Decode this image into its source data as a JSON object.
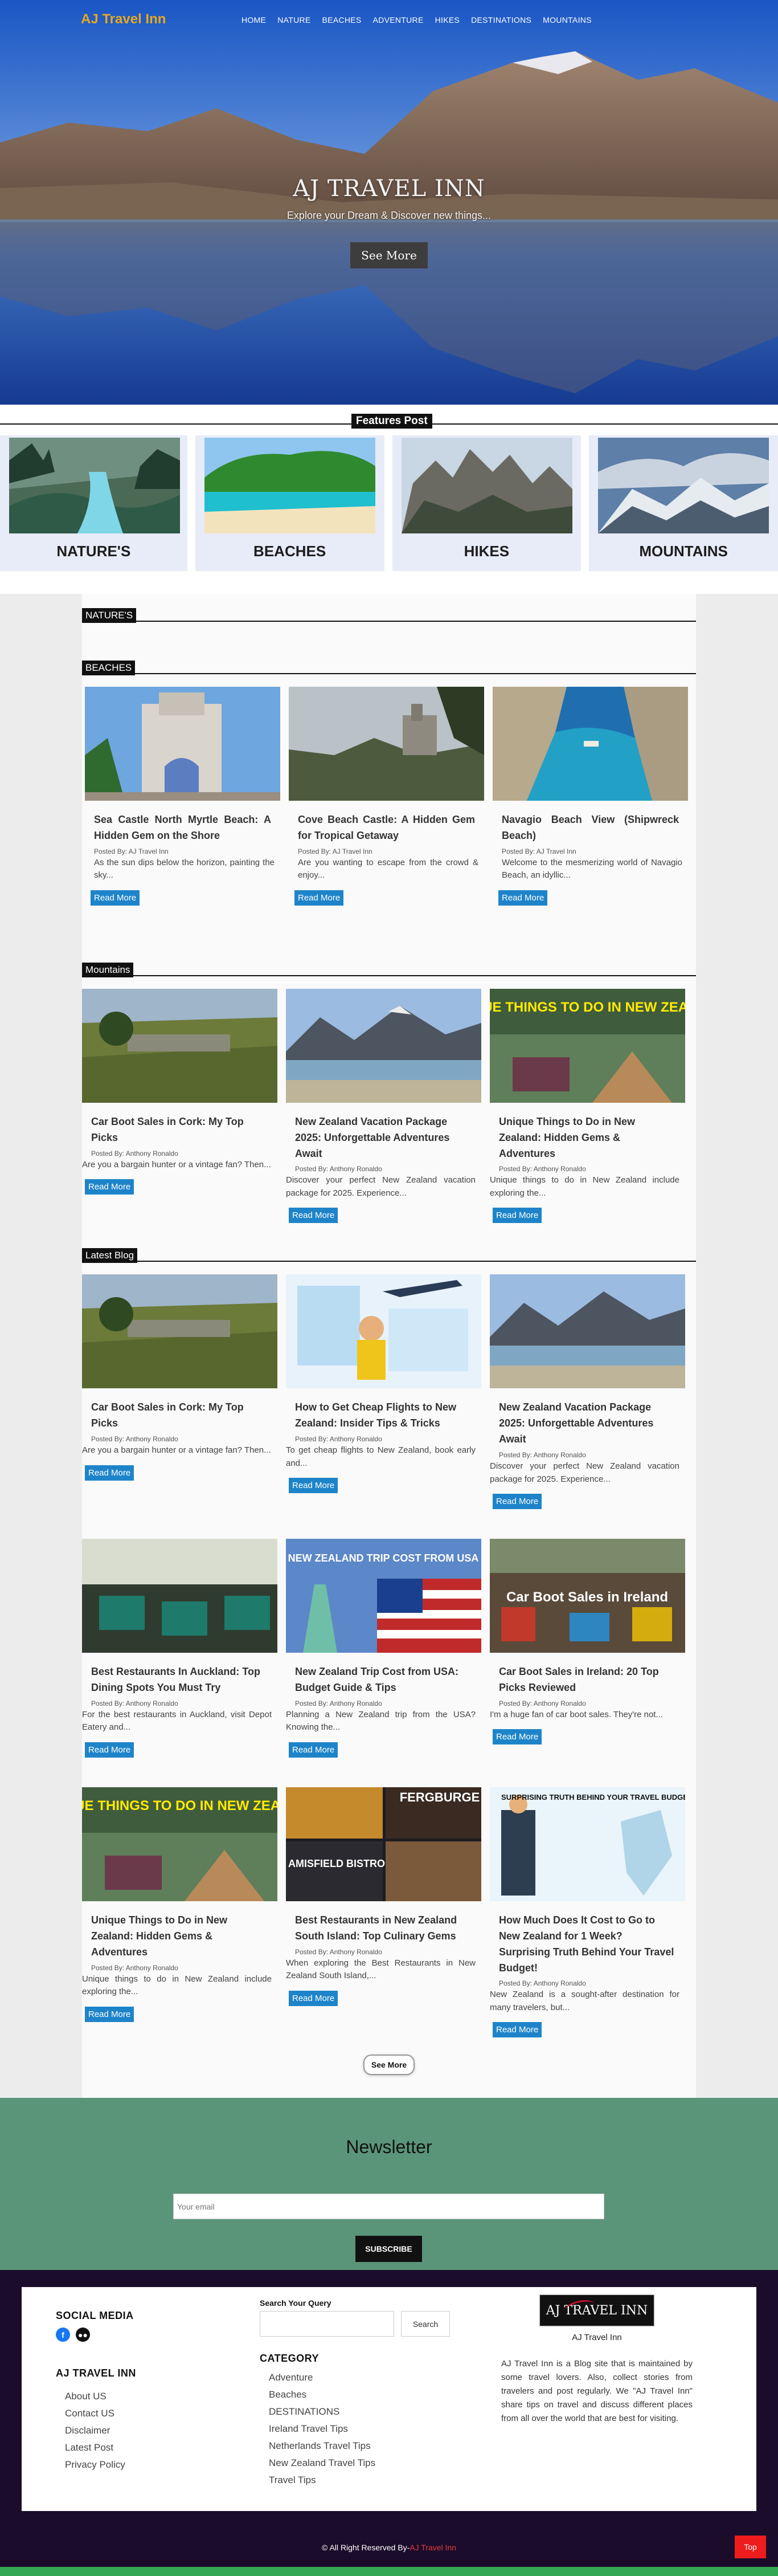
{
  "header": {
    "logo": "AJ Travel Inn",
    "menu": [
      "HOME",
      "NATURE",
      "BEACHES",
      "ADVENTURE",
      "HIKES",
      "DESTINATIONS",
      "MOUNTAINS"
    ]
  },
  "hero": {
    "title": "AJ TRAVEL INN",
    "subtitle": "Explore your Dream & Discover new things...",
    "button": "See More"
  },
  "features": {
    "heading": "Features Post",
    "cards": [
      "NATURE'S",
      "BEACHES",
      "HIKES",
      "MOUNTAINS"
    ]
  },
  "sections": {
    "nature": "NATURE'S",
    "beaches": "BEACHES",
    "mountains": "Mountains",
    "latest": "Latest Blog"
  },
  "beach_posts": [
    {
      "title": "Sea Castle North Myrtle Beach: A Hidden Gem on the Shore",
      "by": "Posted By: AJ Travel Inn",
      "excerpt": "As the sun dips below the horizon, painting the sky...",
      "button": "Read More"
    },
    {
      "title": "Cove Beach Castle: A Hidden Gem for Tropical Getaway",
      "by": "Posted By: AJ Travel Inn",
      "excerpt": "Are you wanting to escape from the crowd & enjoy...",
      "button": "Read More"
    },
    {
      "title": "Navagio Beach View (Shipwreck Beach)",
      "by": "Posted By: AJ Travel Inn",
      "excerpt": "Welcome to the mesmerizing world of Navagio Beach, an idyllic...",
      "button": "Read More"
    }
  ],
  "mountain_posts": [
    {
      "title": "Car Boot Sales in Cork: My Top Picks",
      "by": "Posted By: Anthony Ronaldo",
      "excerpt": "Are you a bargain hunter or a vintage fan? Then...",
      "button": "Read More"
    },
    {
      "title": "New Zealand Vacation Package 2025: Unforgettable Adventures Await",
      "by": "Posted By: Anthony Ronaldo",
      "excerpt": "Discover your perfect New Zealand vacation package for 2025. Experience...",
      "button": "Read More"
    },
    {
      "title": "Unique Things to Do in New Zealand: Hidden Gems & Adventures",
      "by": "Posted By: Anthony Ronaldo",
      "excerpt": "Unique things to do in New Zealand include exploring the...",
      "button": "Read More",
      "overlay": "UNIQUE THINGS TO DO IN NEW ZEALAND"
    }
  ],
  "latest_posts": [
    {
      "title": "Car Boot Sales in Cork: My Top Picks",
      "by": "Posted By: Anthony Ronaldo",
      "excerpt": "Are you a bargain hunter or a vintage fan? Then...",
      "button": "Read More"
    },
    {
      "title": "How to Get Cheap Flights to New Zealand: Insider Tips & Tricks",
      "by": "Posted By: Anthony Ronaldo",
      "excerpt": "To get cheap flights to New Zealand, book early and...",
      "button": "Read More"
    },
    {
      "title": "New Zealand Vacation Package 2025: Unforgettable Adventures Await",
      "by": "Posted By: Anthony Ronaldo",
      "excerpt": "Discover your perfect New Zealand vacation package for 2025. Experience...",
      "button": "Read More"
    },
    {
      "title": "Best Restaurants In Auckland: Top Dining Spots You Must Try",
      "by": "Posted By: Anthony Ronaldo",
      "excerpt": "For the best restaurants in Auckland, visit Depot Eatery and...",
      "button": "Read More"
    },
    {
      "title": "New Zealand Trip Cost from USA: Budget Guide & Tips",
      "by": "Posted By: Anthony Ronaldo",
      "excerpt": "Planning a New Zealand trip from the USA? Knowing the...",
      "button": "Read More",
      "overlay": "NEW ZEALAND TRIP COST FROM USA"
    },
    {
      "title": "Car Boot Sales in Ireland: 20 Top Picks Reviewed",
      "by": "Posted By: Anthony Ronaldo",
      "excerpt": "I'm a huge fan of car boot sales. They're not...",
      "button": "Read More",
      "overlay": "Car Boot Sales in Ireland"
    },
    {
      "title": "Unique Things to Do in New Zealand: Hidden Gems & Adventures",
      "by": "Posted By: Anthony Ronaldo",
      "excerpt": "Unique things to do in New Zealand include exploring the...",
      "button": "Read More",
      "overlay": "UNIQUE THINGS TO DO IN NEW ZEALAND"
    },
    {
      "title": "Best Restaurants in New Zealand South Island: Top Culinary Gems",
      "by": "Posted By: Anthony Ronaldo",
      "excerpt": "When exploring the Best Restaurants in New Zealand South Island,...",
      "button": "Read More",
      "overlay_a": "FERGBURGE",
      "overlay_b": "AMISFIELD BISTRO"
    },
    {
      "title": "How Much Does It Cost to Go to New Zealand for 1 Week? Surprising Truth Behind Your Travel Budget!",
      "by": "Posted By: Anthony Ronaldo",
      "excerpt": "New Zealand is a sought-after destination for many travelers, but...",
      "button": "Read More",
      "overlay": "SURPRISING TRUTH BEHIND YOUR TRAVEL BUDGET!"
    }
  ],
  "see_more": "See More",
  "newsletter": {
    "title": "Newsletter",
    "placeholder": "Your email",
    "button": "SUBSCRIBE"
  },
  "footer": {
    "social_title": "SOCIAL MEDIA",
    "brand_title": "AJ TRAVEL INN",
    "links": [
      "About US",
      "Contact US",
      "Disclaimer",
      "Latest Post",
      "Privacy Policy"
    ],
    "search_label": "Search Your Query",
    "search_button": "Search",
    "category_title": "CATEGORY",
    "categories": [
      "Adventure",
      "Beaches",
      "DESTINATIONS",
      "Ireland Travel Tips",
      "Netherlands Travel Tips",
      "New Zealand Travel Tips",
      "Travel Tips"
    ],
    "logo_text": "AJ TRAVEL INN",
    "site_name": "AJ Travel Inn",
    "about": "AJ Travel Inn is a Blog site that is maintained by some travel lovers. Also, collect stories from travelers and post regularly. We \"AJ Travel Inn\" share tips on travel and discuss different places from all over the world that are best for visiting.",
    "copyright_prefix": "© All Right Reserved By-",
    "copyright_brand": "AJ Travel Inn",
    "top_button": "Top"
  },
  "colors": {
    "logo": "#e6a820",
    "read_more": "#1e84c9",
    "newsletter_bg": "#5a957a",
    "footer_bg": "#1b0c2b",
    "top_button": "#ee1c1c"
  }
}
